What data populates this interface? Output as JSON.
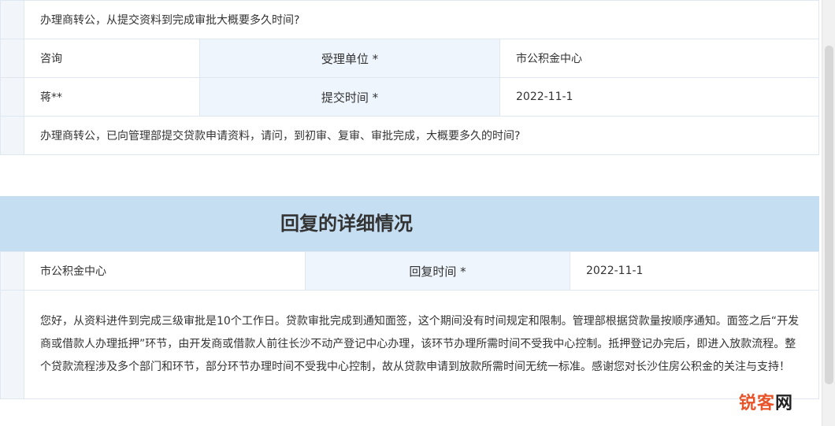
{
  "question": {
    "title_text": "办理商转公，从提交资料到完成审批大概要多久时间?",
    "type": "咨询",
    "unit_label": "受理单位 *",
    "unit_value": "市公积金中心",
    "submitter": "蒋**",
    "time_label": "提交时间 *",
    "time_value": "2022-11-1",
    "content": "办理商转公，已向管理部提交贷款申请资料，请问，到初审、复审、审批完成，大概要多久的时间?"
  },
  "reply": {
    "section_title": "回复的详细情况",
    "unit": "市公积金中心",
    "time_label": "回复时间 *",
    "time_value": "2022-11-1",
    "content": "您好，从资料进件到完成三级审批是10个工作日。贷款审批完成到通知面签，这个期间没有时间规定和限制。管理部根据贷款量按顺序通知。面签之后“开发商或借款人办理抵押”环节，由开发商或借款人前往长沙不动产登记中心办理，该环节办理所需时间不受我中心控制。抵押登记办完后，即进入放款流程。整个贷款流程涉及多个部门和环节，部分环节办理时间不受我中心控制，故从贷款申请到放款所需时间无统一标准。感谢您对长沙住房公积金的关注与支持！"
  },
  "watermark": {
    "part1": "锐客",
    "part2": "网"
  }
}
